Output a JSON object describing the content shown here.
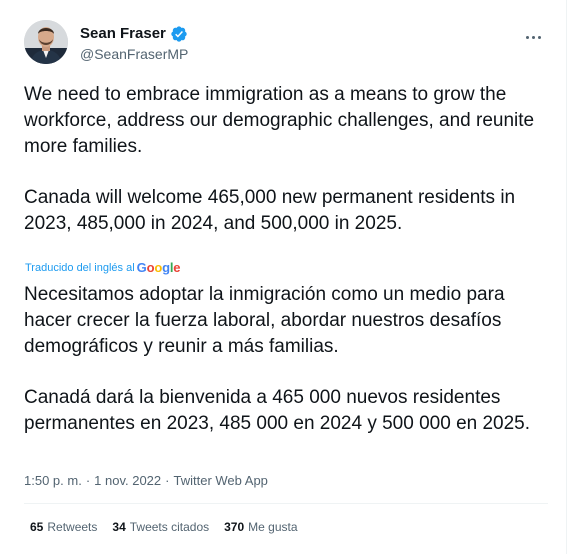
{
  "author": {
    "display_name": "Sean Fraser",
    "handle": "@SeanFraserMP",
    "verified_icon": "verified-badge-icon",
    "avatar_icon": "avatar-photo"
  },
  "menu": {
    "more_icon": "more-dots-icon"
  },
  "tweet": {
    "paragraph_1": "We need to embrace immigration as a means to grow the workforce, address our demographic challenges, and reunite more families.",
    "paragraph_2": "Canada will welcome 465,000 new permanent residents in 2023, 485,000 in 2024, and 500,000 in 2025."
  },
  "translation": {
    "label": "Traducido del inglés al",
    "provider": "Google",
    "paragraph_1": "Necesitamos adoptar la inmigración como un medio para hacer crecer la fuerza laboral, abordar nuestros desafíos demográficos y reunir a más familias.",
    "paragraph_2": "Canadá dará la bienvenida a 465 000 nuevos residentes permanentes en 2023, 485 000 en 2024 y 500 000 en 2025."
  },
  "meta": {
    "time": "1:50 p. m.",
    "separator": "·",
    "date": "1 nov. 2022",
    "source": "Twitter Web App"
  },
  "stats": {
    "retweets_count": "65",
    "retweets_label": "Retweets",
    "quotes_count": "34",
    "quotes_label": "Tweets citados",
    "likes_count": "370",
    "likes_label": "Me gusta"
  },
  "colors": {
    "accent": "#1d9bf0",
    "secondary_text": "#536471",
    "primary_text": "#0f1419"
  }
}
